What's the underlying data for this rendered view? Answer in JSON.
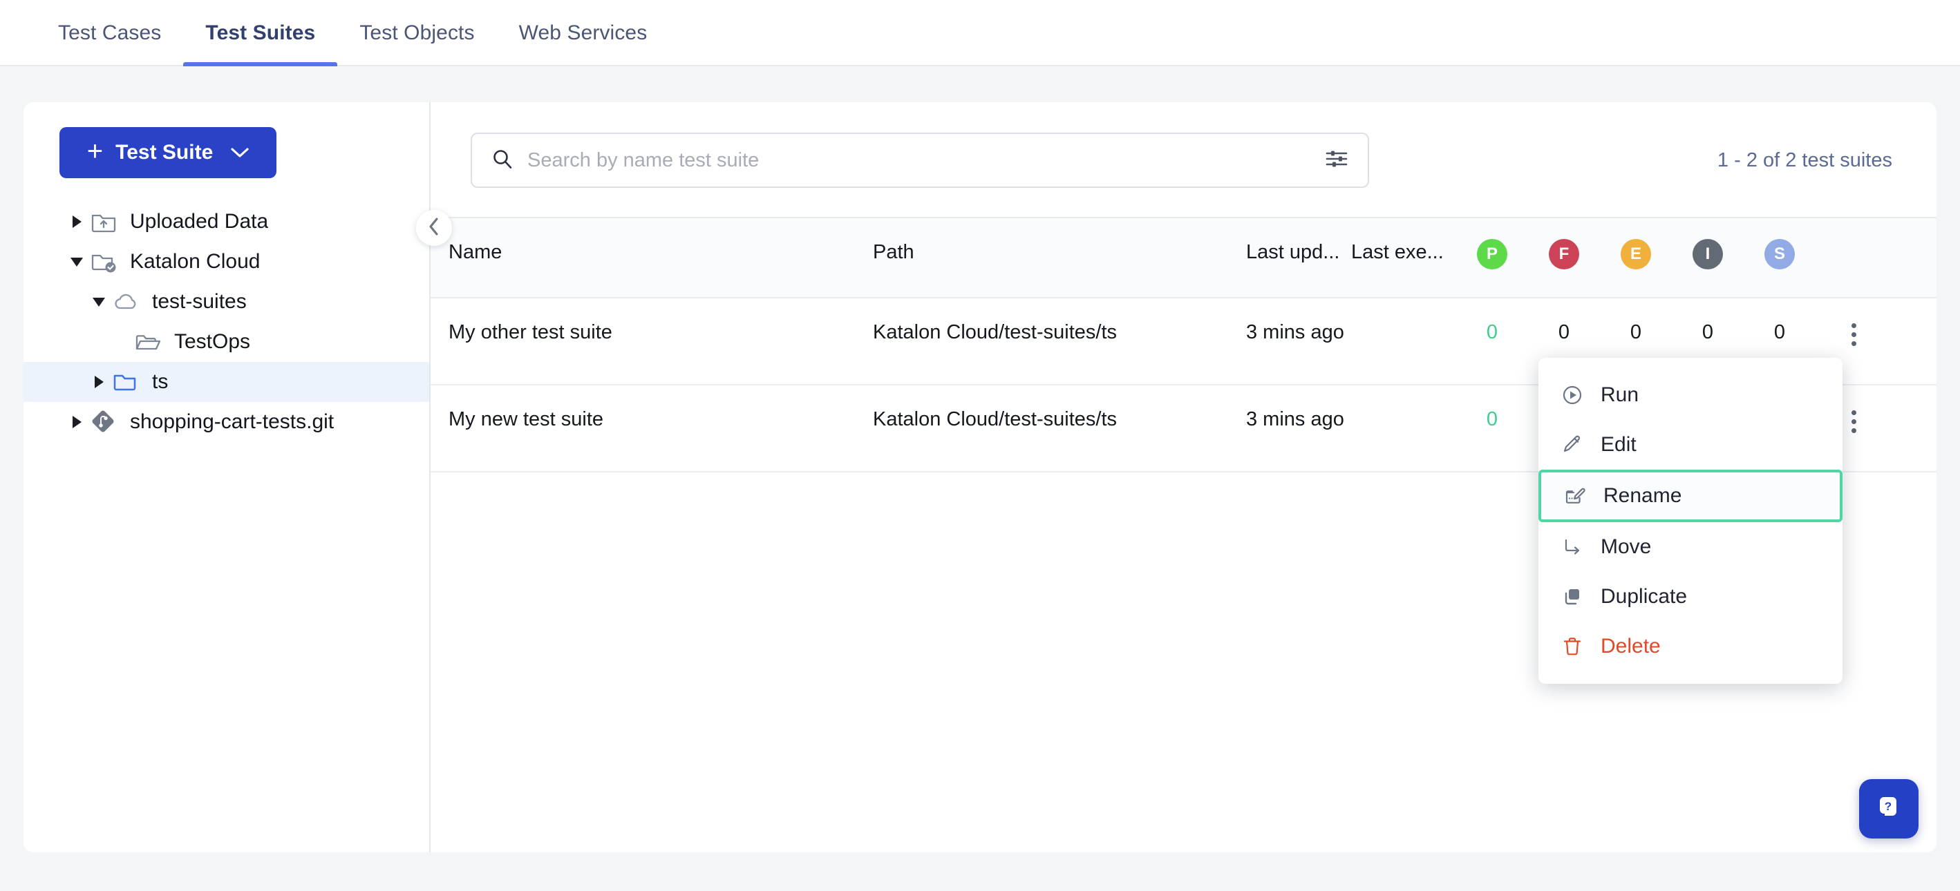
{
  "tabs": [
    {
      "label": "Test Cases",
      "active": false
    },
    {
      "label": "Test Suites",
      "active": true
    },
    {
      "label": "Test Objects",
      "active": false
    },
    {
      "label": "Web Services",
      "active": false
    }
  ],
  "sidebar": {
    "new_button": {
      "label": "Test Suite",
      "plus": "+",
      "caret_icon": "chevron-down-icon"
    },
    "collapse_icon": "chevron-left-icon",
    "tree": [
      {
        "label": "Uploaded Data",
        "icon": "folder-upload-icon",
        "twisty": "right",
        "indent": 0,
        "selected": false
      },
      {
        "label": "Katalon Cloud",
        "icon": "folder-check-icon",
        "twisty": "down",
        "indent": 0,
        "selected": false
      },
      {
        "label": "test-suites",
        "icon": "cloud-icon",
        "twisty": "down",
        "indent": 1,
        "selected": false
      },
      {
        "label": "TestOps",
        "icon": "folder-open-icon",
        "twisty": "none",
        "indent": 2,
        "selected": false
      },
      {
        "label": "ts",
        "icon": "folder-blue-icon",
        "twisty": "right",
        "indent": 1,
        "selected": true
      },
      {
        "label": "shopping-cart-tests.git",
        "icon": "git-icon",
        "twisty": "right",
        "indent": 0,
        "selected": false
      }
    ]
  },
  "search": {
    "placeholder": "Search by name test suite",
    "value": "",
    "search_icon": "search-icon",
    "filter_icon": "filter-sliders-icon"
  },
  "result_count": "1 - 2 of 2 test suites",
  "table": {
    "headers": {
      "name": "Name",
      "path": "Path",
      "last_updated": "Last upd...",
      "last_executed": "Last exe..."
    },
    "status_columns": [
      {
        "letter": "P",
        "name": "passed-badge",
        "color": "#5ed94a"
      },
      {
        "letter": "F",
        "name": "failed-badge",
        "color": "#cc4358"
      },
      {
        "letter": "E",
        "name": "error-badge",
        "color": "#efb03c"
      },
      {
        "letter": "I",
        "name": "incomplete-badge",
        "color": "#626a74"
      },
      {
        "letter": "S",
        "name": "skipped-badge",
        "color": "#92aae6"
      }
    ],
    "rows": [
      {
        "name": "My other test suite",
        "path": "Katalon Cloud/test-suites/ts",
        "last_updated": "3 mins ago",
        "last_executed": "",
        "stats": [
          "0",
          "0",
          "0",
          "0",
          "0"
        ]
      },
      {
        "name": "My new test suite",
        "path": "Katalon Cloud/test-suites/ts",
        "last_updated": "3 mins ago",
        "last_executed": "",
        "stats": [
          "0",
          "",
          "",
          "",
          ""
        ]
      }
    ]
  },
  "context_menu": {
    "items": [
      {
        "label": "Run",
        "icon": "play-circle-icon",
        "highlighted": false,
        "danger": false
      },
      {
        "label": "Edit",
        "icon": "pencil-icon",
        "highlighted": false,
        "danger": false
      },
      {
        "label": "Rename",
        "icon": "rename-icon",
        "highlighted": true,
        "danger": false
      },
      {
        "label": "Move",
        "icon": "move-arrow-icon",
        "highlighted": false,
        "danger": false
      },
      {
        "label": "Duplicate",
        "icon": "copy-icon",
        "highlighted": false,
        "danger": false
      },
      {
        "label": "Delete",
        "icon": "trash-icon",
        "highlighted": false,
        "danger": true
      }
    ],
    "highlight_color": "#4fd6a4"
  },
  "help_widget": {
    "icon": "help-question-bubble-icon",
    "color": "#2440c4"
  },
  "colors": {
    "primary_blue": "#2a43c6",
    "tab_underline": "#5574e8",
    "link_blue": "#4a72ea",
    "selected_row_bg": "#edf3fd",
    "pass_green": "#3ecf8e",
    "delete_red": "#e04a26"
  }
}
